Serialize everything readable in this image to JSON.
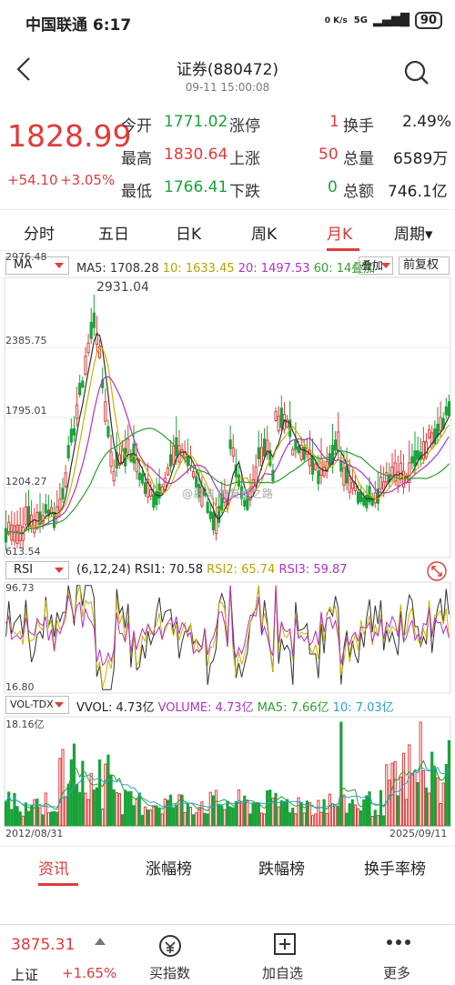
{
  "status": {
    "carrier_time": "中国联通 6:17",
    "net": "0 K/s",
    "signal": "5G",
    "battery": "90"
  },
  "header": {
    "title": "证券(880472)",
    "datetime": "09-11 15:00:08"
  },
  "quote": {
    "price": "1828.99",
    "change": "+54.10",
    "change_pct": "+3.05%",
    "rows": [
      {
        "l1": "今开",
        "v1": "1771.02",
        "l2": "涨停",
        "v2": "1",
        "l3": "换手",
        "v3": "2.49%"
      },
      {
        "l1": "最高",
        "v1": "1830.64",
        "l2": "上涨",
        "v2": "50",
        "l3": "总量",
        "v3": "6589万"
      },
      {
        "l1": "最低",
        "v1": "1766.41",
        "l2": "下跌",
        "v2": "0",
        "l3": "总额",
        "v3": "746.1亿"
      }
    ]
  },
  "tabs": [
    "分时",
    "五日",
    "日K",
    "周K",
    "月K",
    "周期▾"
  ],
  "main_chart": {
    "indicator": "MA",
    "legend": {
      "ma5": "MA5: 1708.28",
      "ma10": "10: 1633.45",
      "ma20": "20: 1497.53",
      "ma60": "60: 14叠加"
    },
    "overlay_btn": "叠加",
    "restore_btn": "前复权",
    "y_labels": [
      "2976.48",
      "2385.75",
      "1795.01",
      "1204.27",
      "613.54"
    ],
    "peak_label": "2931.04",
    "watermark": "@慕清 的复盘之路",
    "colors": {
      "ma5": "#333333",
      "ma10": "#c9b400",
      "ma20": "#b431c4",
      "ma60": "#2f9e2f"
    }
  },
  "rsi_chart": {
    "indicator": "RSI",
    "params": "(6,12,24)",
    "rsi1": "RSI1: 70.58",
    "rsi2": "RSI2: 65.74",
    "rsi3": "RSI3: 59.87",
    "y_top": "96.73",
    "y_bottom": "16.80"
  },
  "vol_chart": {
    "indicator": "VOL-TDX",
    "vvol": "VVOL: 4.73亿",
    "volume": "VOLUME: 4.73亿",
    "ma5": "MA5: 7.66亿",
    "ma10": "10: 7.03亿",
    "y_top": "18.16亿",
    "date_start": "2012/08/31",
    "date_end": "2025/09/11"
  },
  "news_tabs": [
    "资讯",
    "涨幅榜",
    "跌幅榜",
    "换手率榜"
  ],
  "bottom": {
    "index_value": "3875.31",
    "index_name": "上证",
    "index_pct": "+1.65%",
    "items": [
      "买指数",
      "加自选",
      "更多"
    ]
  }
}
